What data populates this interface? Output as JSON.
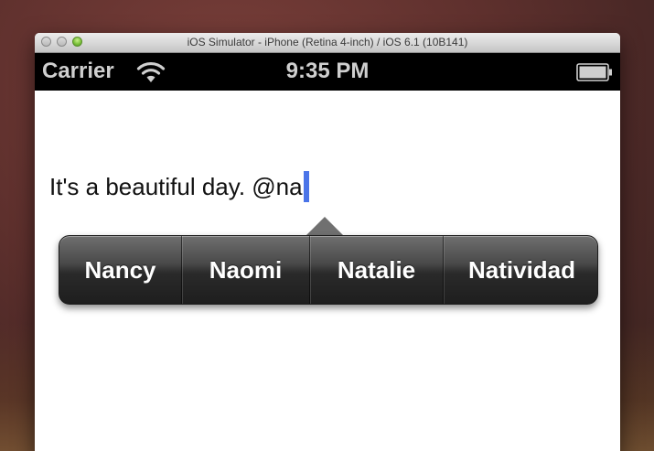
{
  "window": {
    "title": "iOS Simulator - iPhone (Retina 4-inch) / iOS 6.1 (10B141)"
  },
  "statusbar": {
    "carrier": "Carrier",
    "time": "9:35 PM",
    "wifi_icon": "wifi-icon",
    "battery_icon": "battery-icon"
  },
  "editor": {
    "text": "It's a beautiful day. @na"
  },
  "suggestions": [
    {
      "label": "Nancy"
    },
    {
      "label": "Naomi"
    },
    {
      "label": "Natalie"
    },
    {
      "label": "Natividad"
    }
  ],
  "colors": {
    "caret": "#4a74e8",
    "statusbar": "#000000"
  }
}
